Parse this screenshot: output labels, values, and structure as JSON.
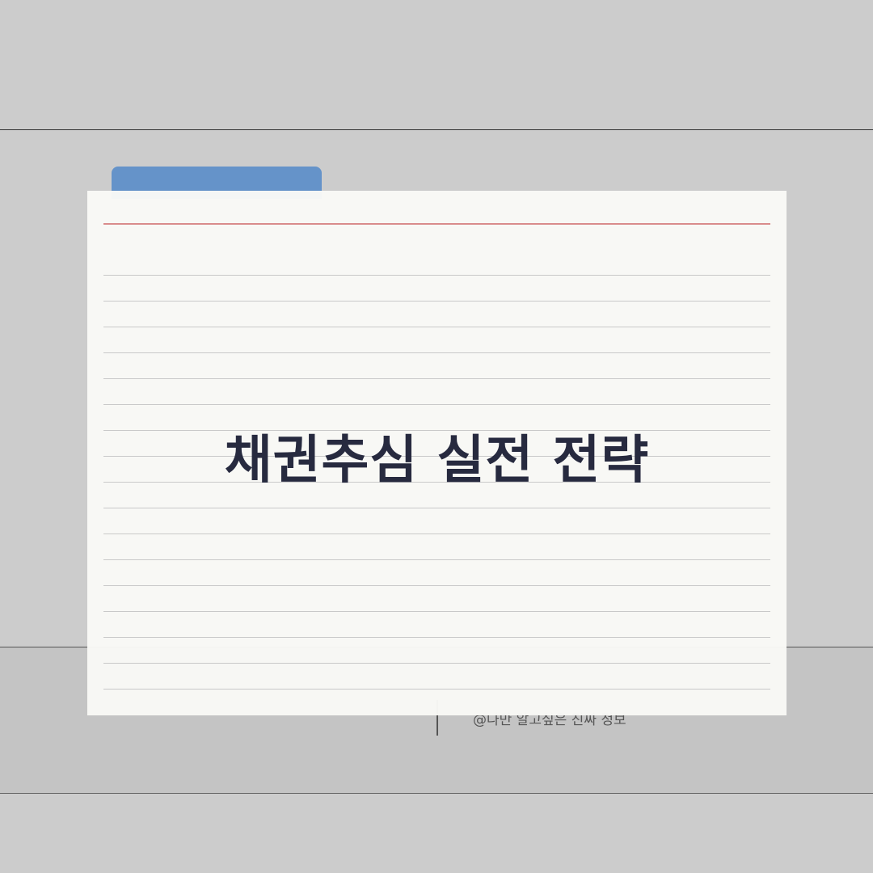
{
  "card": {
    "title": "채권추심 실전 전략"
  },
  "footer": {
    "caption": "@나만 알고싶은 진짜 정보"
  },
  "colors": {
    "background": "#cccccc",
    "tab": "#6593c9",
    "paper": "#f9f9f6",
    "red_rule": "#d98c8c",
    "title_text": "#272a3f"
  }
}
